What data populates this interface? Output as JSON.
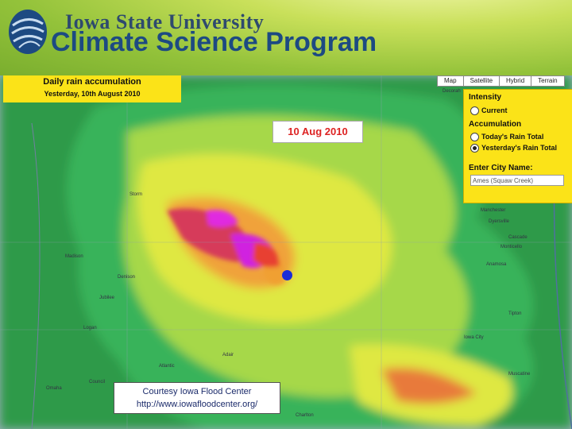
{
  "header": {
    "university": "Iowa State University",
    "program": "Climate Science Program",
    "logo_icon": "isu-globe-logo"
  },
  "map_title": {
    "line1": "Daily rain accumulation",
    "line2": "Yesterday, 10th August 2010"
  },
  "date_label": "10 Aug 2010",
  "map_types": [
    "Map",
    "Satellite",
    "Hybrid",
    "Terrain"
  ],
  "panel": {
    "intensity_heading": "Intensity",
    "current_label": "Current",
    "accumulation_heading": "Accumulation",
    "today_label": "Today's Rain Total",
    "yesterday_label": "Yesterday's Rain Total",
    "selected": "Yesterday's Rain Total",
    "city_heading": "Enter City Name:",
    "city_value": "Ames (Squaw Creek)"
  },
  "credit": {
    "line1": "Courtesy Iowa Flood Center",
    "line2": "http://www.iowafloodcenter.org/"
  },
  "colors": {
    "header_green": "#93c23a",
    "panel_yellow": "#fbe318",
    "date_red": "#d22222",
    "marker_blue": "#1a2cd8"
  },
  "place_names": [
    "Decorah",
    "Storm",
    "Madison",
    "Denison",
    "Jubilee",
    "Logan",
    "Council",
    "Omaha",
    "Atlantic",
    "Adair",
    "Manchester",
    "Dyersville",
    "Cascade",
    "Monticello",
    "Anamosa",
    "Tipton",
    "Iowa City",
    "Muscatine",
    "Charlton"
  ]
}
